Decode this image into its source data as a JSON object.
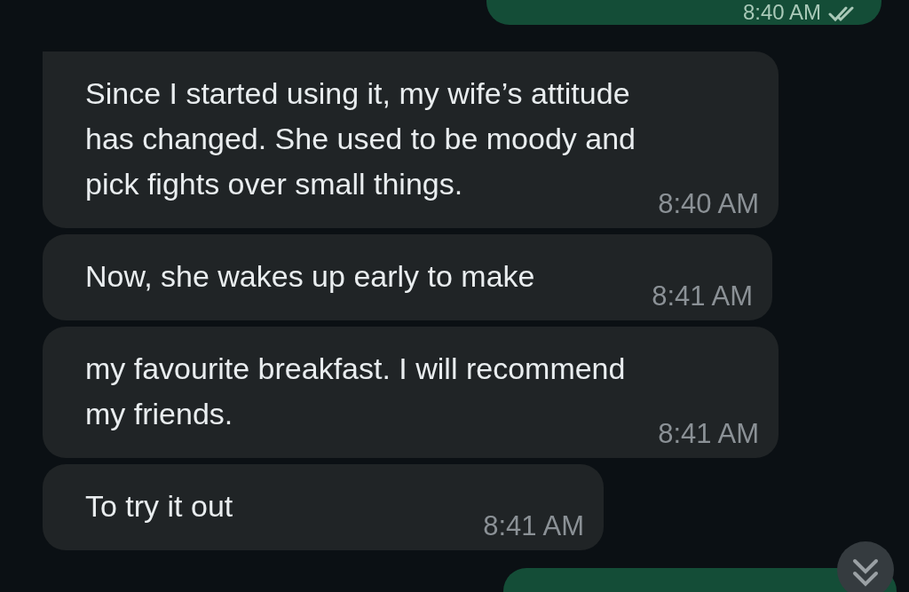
{
  "messages": [
    {
      "kind": "outgoing",
      "time": "8:40 AM",
      "read": false
    },
    {
      "kind": "incoming",
      "text": "Since I started using it, my wife’s attitude has changed. She used to be moody and pick fights over small things.",
      "time": "8:40 AM",
      "tail": true
    },
    {
      "kind": "incoming",
      "text": "Now, she wakes up early to make",
      "time": "8:41 AM",
      "tail": false
    },
    {
      "kind": "incoming",
      "text": "my favourite breakfast. I will recommend my friends.",
      "time": "8:41 AM",
      "tail": false
    },
    {
      "kind": "incoming",
      "text": "To try it out",
      "time": "8:41 AM",
      "tail": false
    },
    {
      "kind": "outgoing"
    }
  ],
  "scroll_down_button": {
    "visible": true
  }
}
